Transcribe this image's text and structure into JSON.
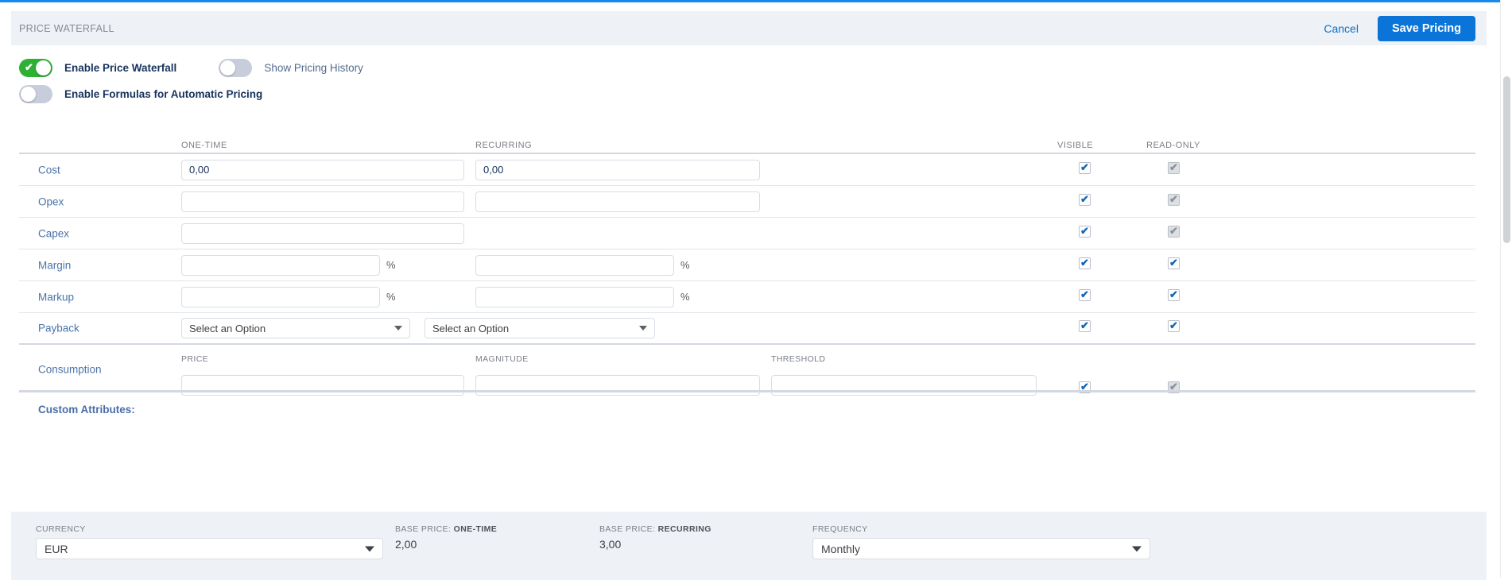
{
  "theme": {
    "accent": "#0a74d9",
    "header_bg": "#eef1f6",
    "toggle_on": "#2eb035",
    "toggle_off": "#c7cddb",
    "label_link": "#4a74a8"
  },
  "header": {
    "title": "PRICE WATERFALL",
    "cancel_label": "Cancel",
    "save_label": "Save Pricing"
  },
  "toggles": [
    {
      "label": "Enable Price Waterfall",
      "state": "on",
      "emphasis": "bold"
    },
    {
      "label": "Show Pricing History",
      "state": "off",
      "emphasis": "normal"
    },
    {
      "label": "Enable Formulas for Automatic Pricing",
      "state": "off",
      "emphasis": "bold"
    }
  ],
  "table": {
    "columns": {
      "one_time": "ONE-TIME",
      "recurring": "RECURRING",
      "visible": "VISIBLE",
      "read_only": "READ-ONLY"
    },
    "rows": [
      {
        "label": "Cost",
        "one_time_value": "0,00",
        "recurring_value": "0,00",
        "visible": "checked",
        "read_only": "checked-disabled"
      },
      {
        "label": "Opex",
        "one_time_value": "",
        "recurring_value": "",
        "visible": "checked",
        "read_only": "checked-disabled"
      },
      {
        "label": "Capex",
        "one_time_value": "",
        "recurring_value": null,
        "visible": "checked",
        "read_only": "checked-disabled"
      },
      {
        "label": "Margin",
        "one_time_value": "",
        "recurring_value": "",
        "suffix": "%",
        "visible": "checked",
        "read_only": "checked"
      },
      {
        "label": "Markup",
        "one_time_value": "",
        "recurring_value": "",
        "suffix": "%",
        "visible": "checked",
        "read_only": "checked"
      },
      {
        "label": "Payback",
        "one_time_value": "Select an Option",
        "recurring_value": "Select an Option",
        "visible": "checked",
        "read_only": "checked"
      },
      {
        "label": "Consumption",
        "sub_labels": {
          "price": "PRICE",
          "magnitude": "MAGNITUDE",
          "threshold": "THRESHOLD"
        },
        "price_value": "",
        "magnitude_value": "",
        "threshold_value": "",
        "visible": "checked",
        "read_only": "checked-disabled"
      }
    ]
  },
  "custom_attributes": {
    "title": "Custom Attributes:"
  },
  "footer": {
    "currency": {
      "label": "CURRENCY",
      "value": "EUR"
    },
    "base_price_one_time": {
      "label_prefix": "BASE PRICE:",
      "label_suffix": "ONE-TIME",
      "value": "2,00"
    },
    "base_price_recurring": {
      "label_prefix": "BASE PRICE:",
      "label_suffix": "RECURRING",
      "value": "3,00"
    },
    "frequency": {
      "label": "FREQUENCY",
      "value": "Monthly"
    }
  }
}
